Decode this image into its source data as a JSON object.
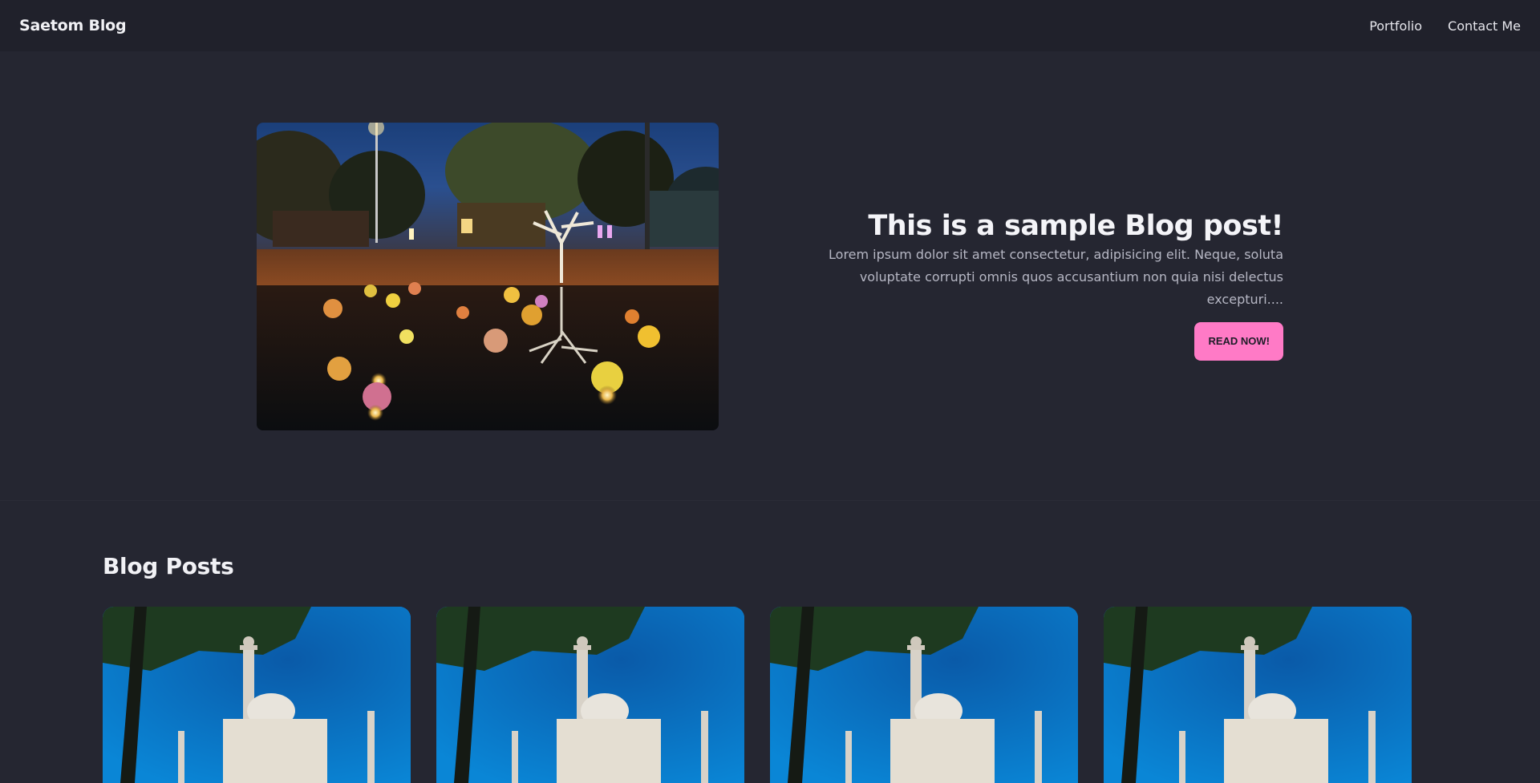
{
  "navbar": {
    "brand": "Saetom Blog",
    "links": [
      "Portfolio",
      "Contact Me"
    ]
  },
  "hero": {
    "image_alt": "night-reflection-photo",
    "title": "This is a sample Blog post!",
    "description": "Lorem ipsum dolor sit amet consectetur, adipisicing elit. Neque, soluta voluptate corrupti omnis quos accusantium non quia nisi delectus excepturi....",
    "button_label": "READ NOW!"
  },
  "posts": {
    "title": "Blog Posts",
    "cards": [
      {
        "image_alt": "taj-mahal-photo"
      },
      {
        "image_alt": "taj-mahal-photo"
      },
      {
        "image_alt": "taj-mahal-photo"
      },
      {
        "image_alt": "taj-mahal-photo"
      }
    ]
  },
  "colors": {
    "background": "#252631",
    "navbar": "#20212b",
    "accent_pink": "#ff7ac6"
  }
}
